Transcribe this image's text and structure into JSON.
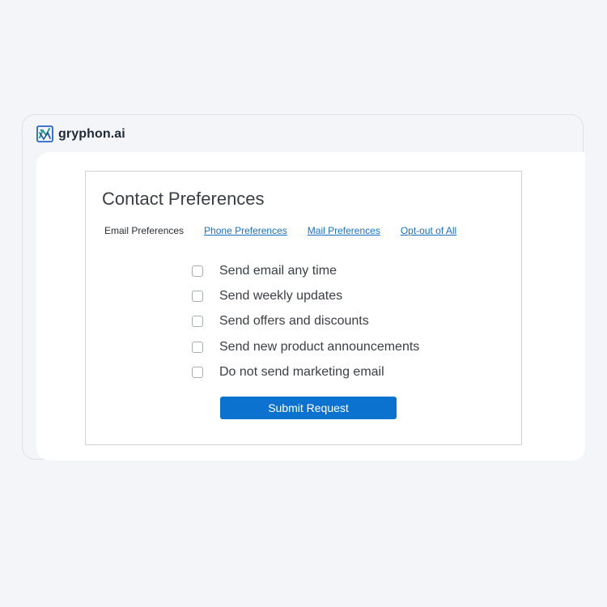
{
  "brand": {
    "name": "gryphon.ai"
  },
  "form": {
    "title": "Contact Preferences",
    "tabs": [
      {
        "label": "Email Preferences",
        "active": true
      },
      {
        "label": "Phone Preferences",
        "active": false
      },
      {
        "label": "Mail Preferences",
        "active": false
      },
      {
        "label": "Opt-out of All",
        "active": false
      }
    ],
    "options": [
      {
        "label": "Send email any time",
        "checked": false
      },
      {
        "label": "Send weekly updates",
        "checked": false
      },
      {
        "label": "Send offers and discounts",
        "checked": false
      },
      {
        "label": "Send new product announcements",
        "checked": false
      },
      {
        "label": "Do not send marketing email",
        "checked": false
      }
    ],
    "submit_label": "Submit Request"
  },
  "colors": {
    "background": "#f4f5f9",
    "accent": "#0b72cf",
    "link": "#1a6fc4",
    "logo_primary": "#2c9a8f",
    "logo_secondary": "#2a63c6"
  }
}
